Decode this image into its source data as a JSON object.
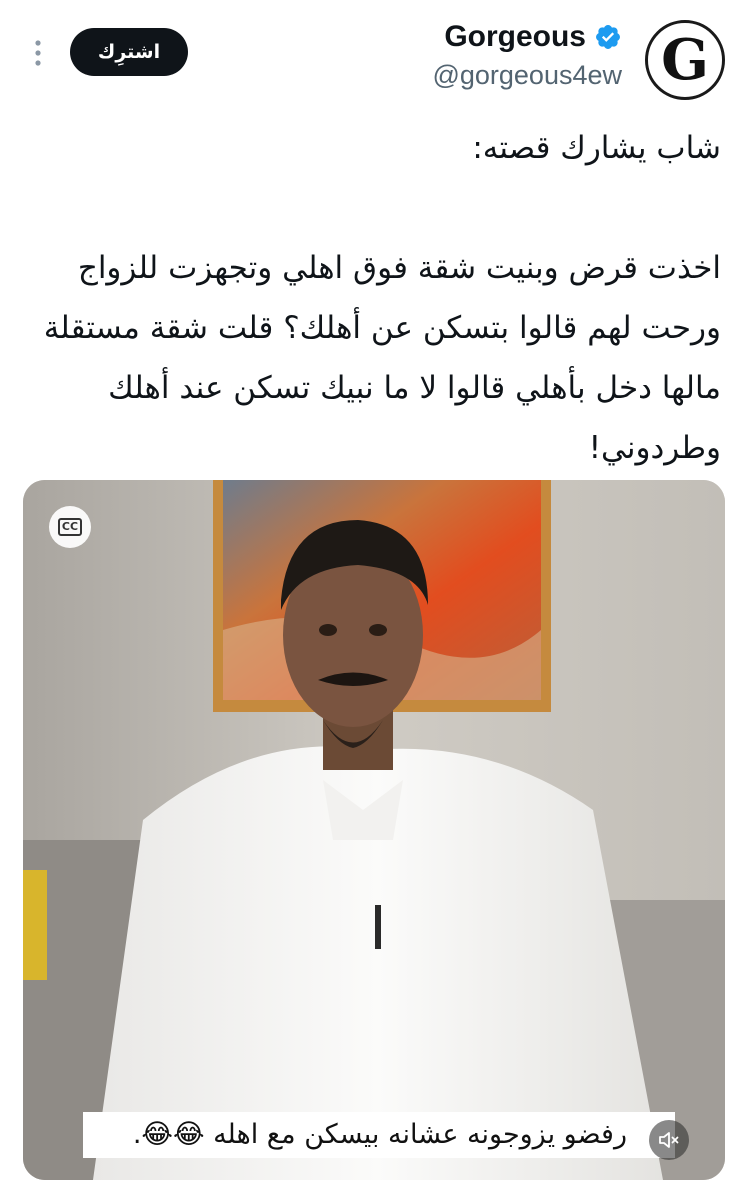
{
  "author": {
    "display_name": "Gorgeous",
    "handle": "@gorgeous4ew",
    "avatar_letter": "G"
  },
  "actions": {
    "subscribe_label": "اشترِك"
  },
  "tweet": {
    "line1": "شاب يشارك قصته:",
    "body_line1": "اخذت قرض وبنيت شقة فوق اهلي وتجهزت للزواج",
    "body_line2": "ورحت لهم قالوا بتسكن عن أهلك؟ قلت شقة مستقلة",
    "body_line3": "مالها دخل بأهلي قالوا لا ما نبيك تسكن عند أهلك",
    "body_line4": "وطردوني!"
  },
  "media": {
    "cc_label": "CC",
    "caption": "رفضو يزوجونه عشانه بيسكن مع اهله 😂😂."
  },
  "icons": {
    "verified": "verified-badge-icon",
    "more": "more-vertical-icon",
    "cc": "closed-captions-icon",
    "mute": "speaker-muted-icon"
  },
  "colors": {
    "verified_blue": "#1d9bf0",
    "button_dark": "#0f1419",
    "handle_gray": "#536471"
  }
}
